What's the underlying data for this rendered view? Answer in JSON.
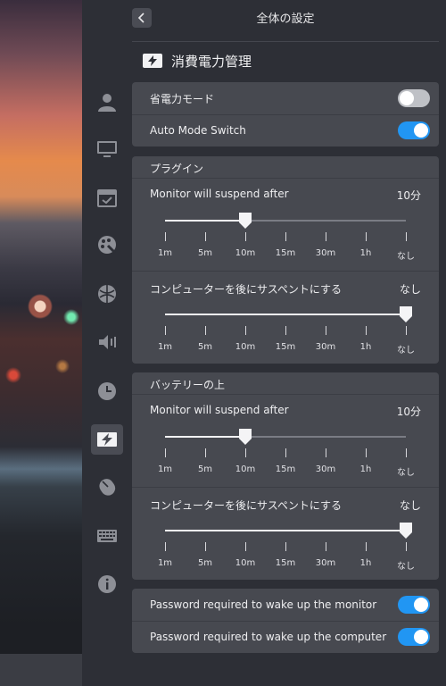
{
  "header": {
    "back_icon": "chevron-left-icon",
    "title": "全体の設定"
  },
  "section": {
    "icon": "power-management-icon",
    "title": "消費電力管理"
  },
  "nav": [
    {
      "name": "account-icon",
      "active": false
    },
    {
      "name": "display-icon",
      "active": false
    },
    {
      "name": "default-apps-icon",
      "active": false
    },
    {
      "name": "personalization-icon",
      "active": false
    },
    {
      "name": "network-icon",
      "active": false
    },
    {
      "name": "sound-icon",
      "active": false
    },
    {
      "name": "time-icon",
      "active": false
    },
    {
      "name": "power-icon",
      "active": true
    },
    {
      "name": "mouse-icon",
      "active": false
    },
    {
      "name": "keyboard-icon",
      "active": false
    },
    {
      "name": "info-icon",
      "active": false
    }
  ],
  "modes": {
    "power_saving": {
      "label": "省電力モード",
      "on": false
    },
    "auto_switch": {
      "label": "Auto Mode Switch",
      "on": true
    }
  },
  "ticks": [
    "1m",
    "5m",
    "10m",
    "15m",
    "30m",
    "1h",
    "なし"
  ],
  "plugged": {
    "title": "プラグイン",
    "monitor": {
      "label": "Monitor will suspend after",
      "value": "10分",
      "position": 2
    },
    "computer": {
      "label": "コンピューターを後にサスペントにする",
      "value": "なし",
      "position": 6
    }
  },
  "battery": {
    "title": "バッテリーの上",
    "monitor": {
      "label": "Monitor will suspend after",
      "value": "10分",
      "position": 2
    },
    "computer": {
      "label": "コンピューターを後にサスペントにする",
      "value": "なし",
      "position": 6
    }
  },
  "password": {
    "monitor": {
      "label": "Password required to wake up the monitor",
      "on": true
    },
    "computer": {
      "label": "Password required to wake up the computer",
      "on": true
    }
  },
  "colors": {
    "accent": "#2196f3",
    "panel": "#2d2f36",
    "card": "#474950"
  }
}
